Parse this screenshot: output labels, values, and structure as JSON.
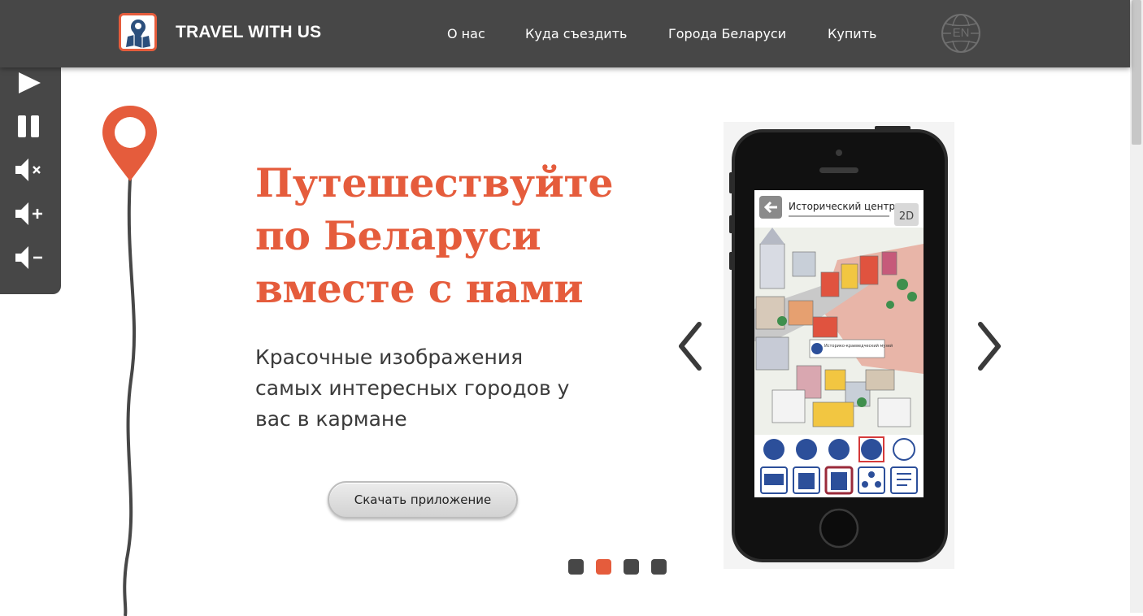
{
  "header": {
    "brand": "TRAVEL WITH US",
    "nav": [
      "О нас",
      "Куда съездить",
      "Города Беларуси",
      "Купить"
    ],
    "language": "EN"
  },
  "media_panel": {
    "buttons": [
      "play-icon",
      "pause-icon",
      "mute-icon",
      "volume-up-icon",
      "volume-down-icon"
    ]
  },
  "hero": {
    "title_lines": [
      "Путешествуйте",
      "по Беларуси",
      "вместе с нами"
    ],
    "subtitle_lines": [
      "Красочные изображения",
      "самых интересных городов у",
      "вас в кармане"
    ],
    "download_button": "Скачать приложение"
  },
  "phone_screen": {
    "title": "Исторический центр",
    "mode": "2D",
    "museum_label": "Историко-краеведческий музей"
  },
  "carousel": {
    "dots": 4,
    "active_dot": 2
  },
  "colors": {
    "accent": "#e55c3c",
    "header_bg": "#474747",
    "text_dark": "#3a3a3a"
  }
}
